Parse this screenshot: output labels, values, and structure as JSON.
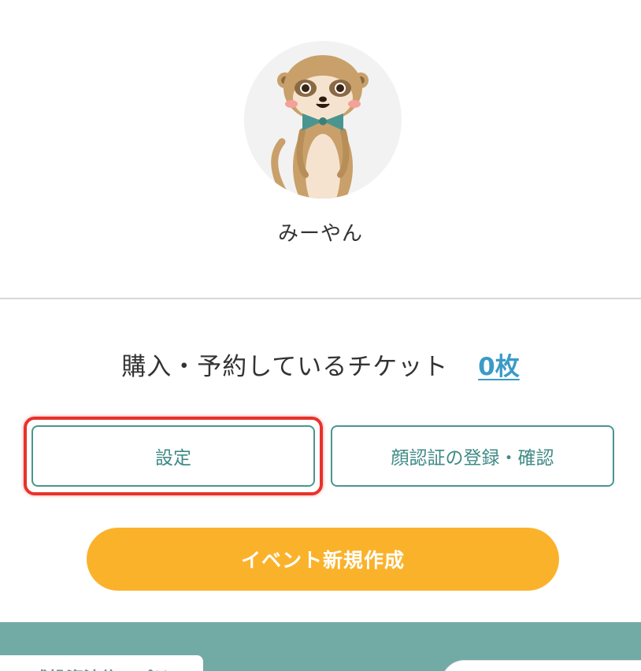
{
  "profile": {
    "avatar_icon": "meerkat-avatar-icon",
    "username": "みーやん"
  },
  "tickets": {
    "label": "購入・予約しているチケット",
    "count": "0枚"
  },
  "actions": {
    "settings_label": "設定",
    "face_auth_label": "顔認証の登録・確認",
    "create_event_label": "イベント新規作成"
  },
  "footer_band": {
    "card_text": "…式投資法信アプリ"
  },
  "colors": {
    "teal": "#4a9590",
    "accent_orange": "#fbb22b",
    "link_blue": "#3a9bc7",
    "highlight_red": "#e8322b",
    "band_teal": "#72aaa6"
  }
}
